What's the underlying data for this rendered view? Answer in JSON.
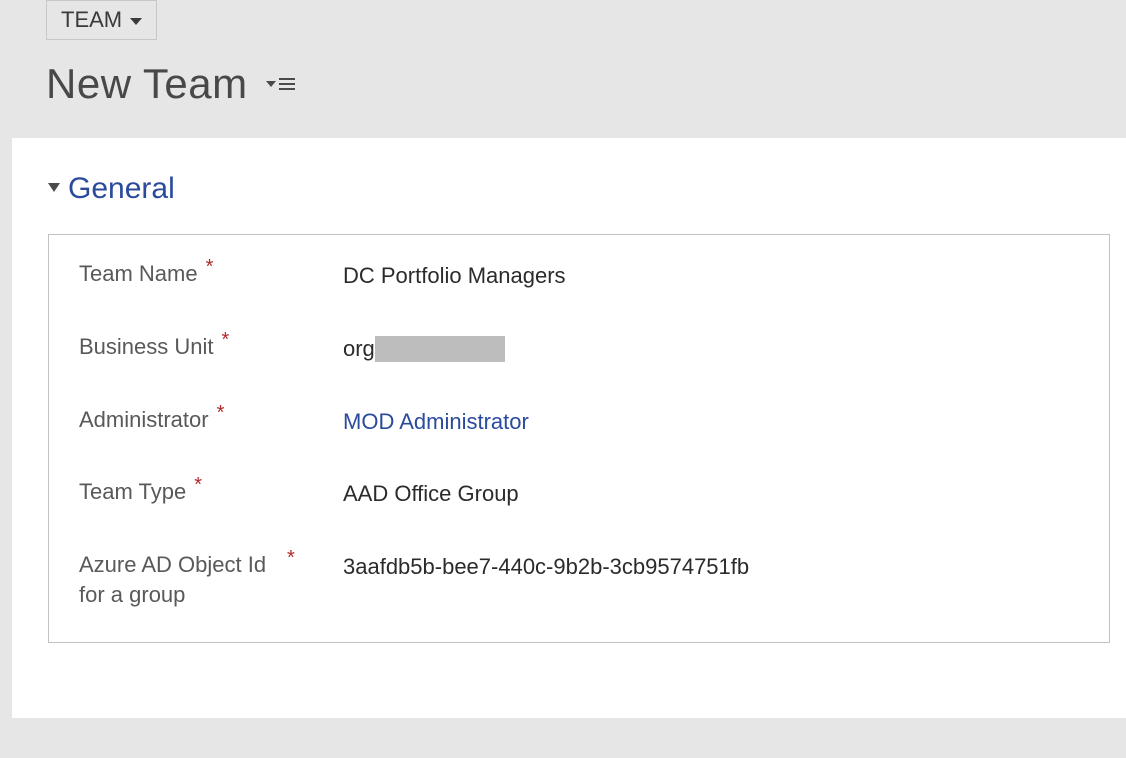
{
  "header": {
    "entity_label": "TEAM",
    "page_title": "New Team"
  },
  "section": {
    "title": "General"
  },
  "fields": {
    "team_name": {
      "label": "Team Name",
      "value": "DC Portfolio Managers"
    },
    "business_unit": {
      "label": "Business Unit",
      "value_prefix": "org"
    },
    "administrator": {
      "label": "Administrator",
      "value": "MOD Administrator"
    },
    "team_type": {
      "label": "Team Type",
      "value": "AAD Office Group"
    },
    "aad_object_id": {
      "label": "Azure AD Object Id for a group",
      "value": "3aafdb5b-bee7-440c-9b2b-3cb9574751fb"
    }
  }
}
